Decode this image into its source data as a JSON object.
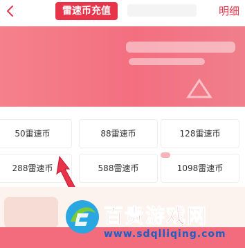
{
  "header": {
    "back_icon": "chevron-left-icon",
    "active_tab": "雷速币充值",
    "detail_link": "明细"
  },
  "colors": {
    "accent": "#e8344a",
    "banner": "#f36f80",
    "watermark_blue": "#1f5fc4"
  },
  "recharge_options": [
    {
      "label": "50雷速币"
    },
    {
      "label": "88雷速币"
    },
    {
      "label": "128雷速币"
    },
    {
      "label": "288雷速币"
    },
    {
      "label": "588雷速币"
    },
    {
      "label": "1098雷速币"
    }
  ],
  "watermark": {
    "title": "百贵游戏网",
    "url": "www.sdqlliqing.com"
  }
}
